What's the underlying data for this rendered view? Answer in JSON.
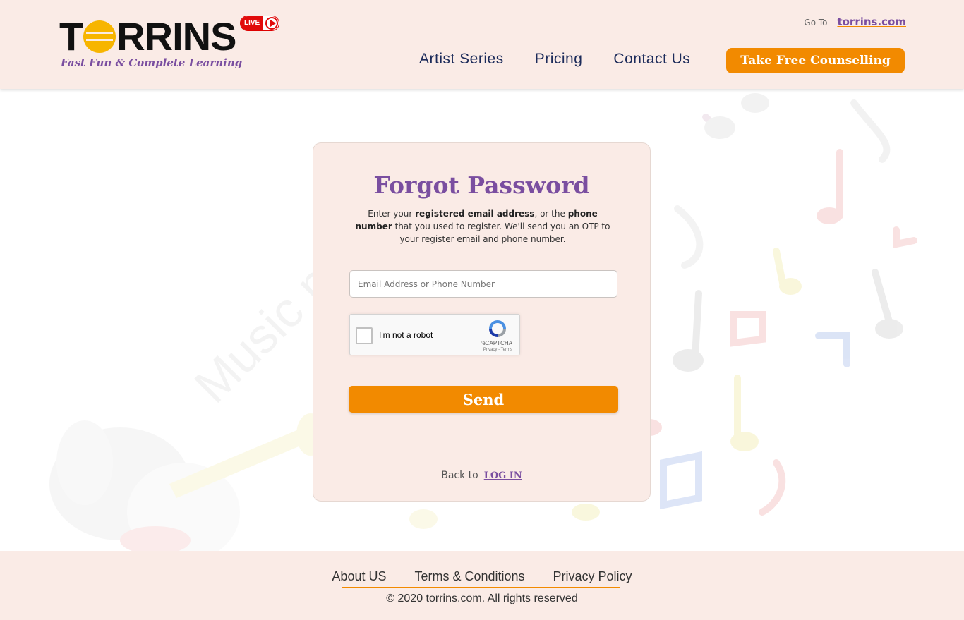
{
  "header": {
    "logo_text_pre": "T",
    "logo_text_post": "RRINS",
    "tagline": "Fast Fun & Complete Learning",
    "live_label": "LIVE",
    "goto_label": "Go To - ",
    "goto_link": "torrins.com",
    "nav": [
      "Artist Series",
      "Pricing",
      "Contact Us"
    ],
    "cta_label": "Take Free Counselling"
  },
  "background": {
    "watermark": "Music m"
  },
  "form": {
    "title": "Forgot Password",
    "desc_1": "Enter your ",
    "desc_b1": "registered email address",
    "desc_2": ", or the ",
    "desc_b2": "phone number",
    "desc_3": " that you used to register. We'll send you an OTP to your register email and phone number.",
    "input_placeholder": "Email Address or Phone Number",
    "captcha_label": "I'm not a robot",
    "captcha_brand": "reCAPTCHA",
    "captcha_links": "Privacy - Terms",
    "send_label": "Send",
    "back_text": "Back to",
    "login_link": "LOG IN"
  },
  "footer": {
    "links": [
      "About US",
      "Terms & Conditions",
      "Privacy Policy"
    ],
    "copyright": "© 2020 torrins.com. All rights reserved"
  },
  "colors": {
    "accent": "#f28a00",
    "brand_purple": "#7a4ea0",
    "panel": "#faebe6"
  }
}
